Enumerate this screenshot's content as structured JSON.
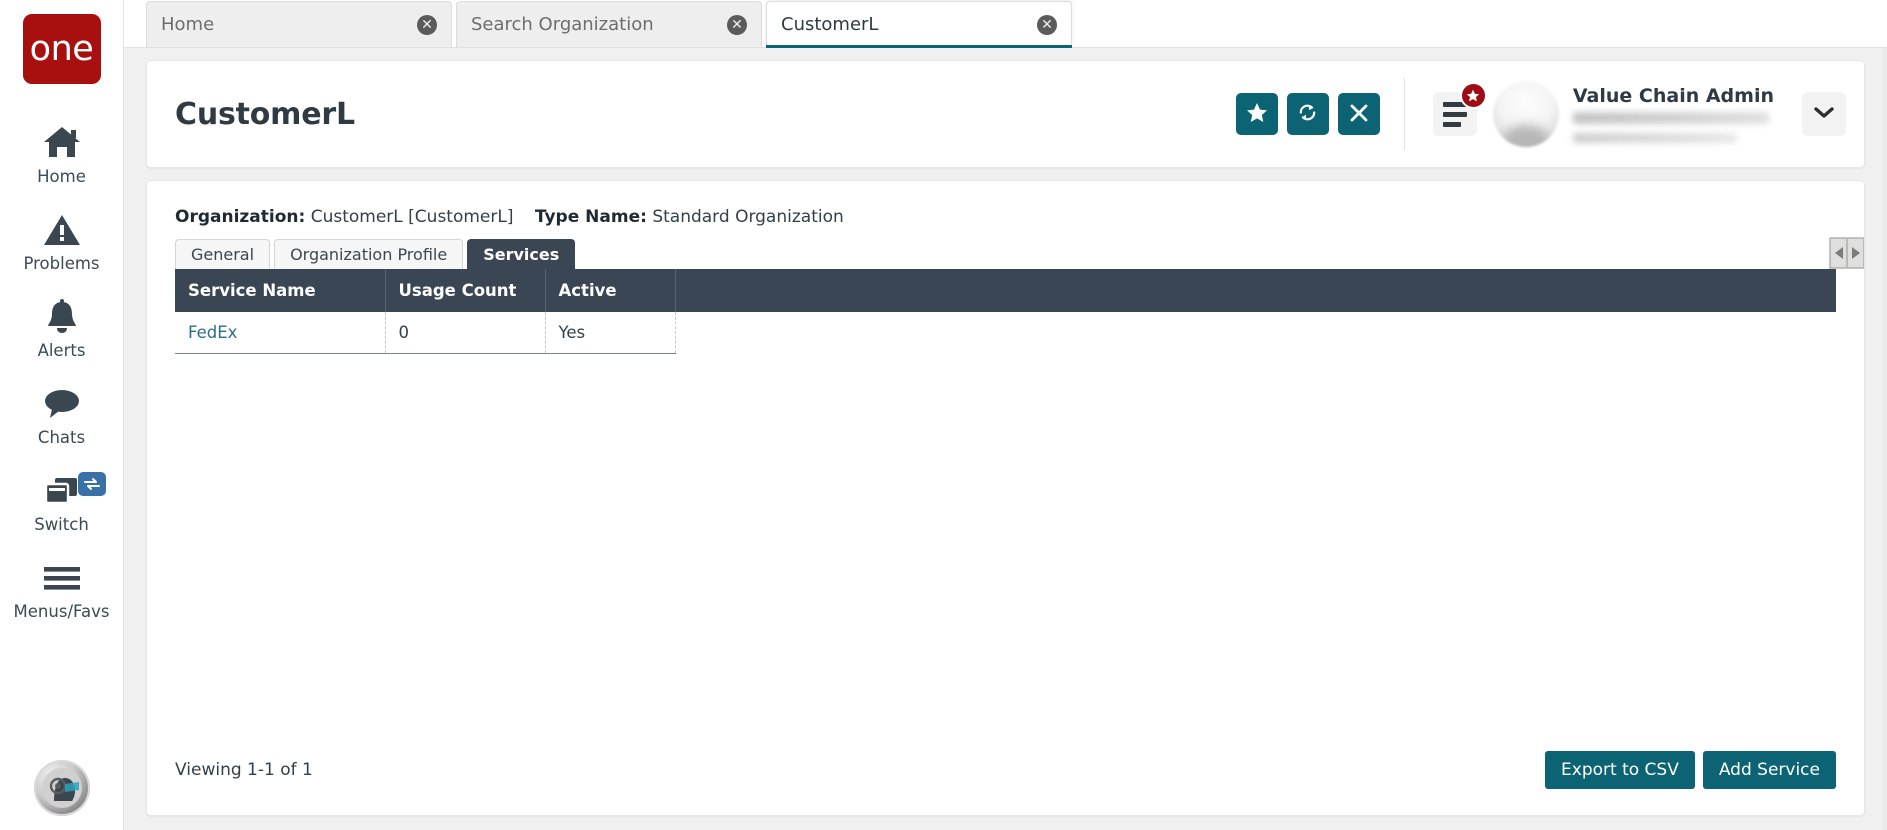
{
  "rail": {
    "logo_text": "one",
    "items": [
      {
        "label": "Home",
        "icon": "home-icon"
      },
      {
        "label": "Problems",
        "icon": "warning-triangle-icon"
      },
      {
        "label": "Alerts",
        "icon": "bell-icon"
      },
      {
        "label": "Chats",
        "icon": "chat-bubble-icon"
      },
      {
        "label": "Switch",
        "icon": "windows-switch-icon",
        "badge_icon": "swap-arrows-icon"
      },
      {
        "label": "Menus/Favs",
        "icon": "hamburger-icon"
      }
    ],
    "assistant_avatar_icon": "ai-assistant-avatar-icon"
  },
  "browser_tabs": [
    {
      "label": "Home",
      "active": false,
      "close_icon": "close-circle-icon"
    },
    {
      "label": "Search Organization",
      "active": false,
      "close_icon": "close-circle-icon"
    },
    {
      "label": "CustomerL",
      "active": true,
      "close_icon": "close-circle-icon"
    }
  ],
  "header": {
    "title": "CustomerL",
    "actions": [
      {
        "name": "favorite",
        "icon": "star-icon"
      },
      {
        "name": "refresh",
        "icon": "refresh-icon"
      },
      {
        "name": "close",
        "icon": "x-icon"
      }
    ],
    "menu_icon": "hamburger-menu-icon",
    "menu_badge_icon": "star-badge-icon",
    "user_name": "Value Chain Admin",
    "caret_icon": "chevron-down-icon"
  },
  "details": {
    "organization_label": "Organization:",
    "organization_value": "CustomerL [CustomerL]",
    "type_name_label": "Type Name:",
    "type_name_value": "Standard Organization"
  },
  "content_tabs": [
    {
      "label": "General",
      "active": false
    },
    {
      "label": "Organization Profile",
      "active": false
    },
    {
      "label": "Services",
      "active": true
    }
  ],
  "tab_scrollers": {
    "left_icon": "triangle-left-icon",
    "right_icon": "triangle-right-icon"
  },
  "table": {
    "columns": [
      "Service Name",
      "Usage Count",
      "Active"
    ],
    "rows": [
      {
        "service_name": "FedEx",
        "usage_count": "0",
        "active": "Yes"
      }
    ]
  },
  "footer": {
    "viewing": "Viewing 1-1 of 1",
    "export_label": "Export to CSV",
    "add_label": "Add Service"
  },
  "colors": {
    "brand_red": "#a81010",
    "accent_teal": "#0b6373",
    "header_dark": "#3b4654",
    "link_teal": "#2d6e85",
    "badge_red": "#9e0b15",
    "switch_blue": "#3a72a8"
  }
}
